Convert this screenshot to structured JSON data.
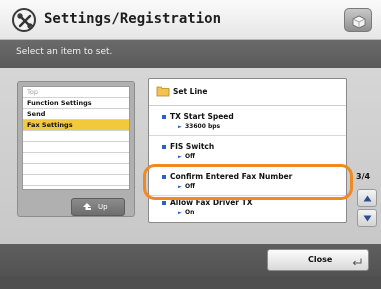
{
  "header": {
    "title": "Settings/Registration",
    "icon": "tools-icon",
    "counter_icon": "counter-check-icon"
  },
  "instruction": "Select an item to set.",
  "path": {
    "items": [
      {
        "label": "Top",
        "state": "dim"
      },
      {
        "label": "Function Settings",
        "state": "normal"
      },
      {
        "label": "Send",
        "state": "normal"
      },
      {
        "label": "Fax Settings",
        "state": "selected"
      }
    ],
    "up_label": "Up"
  },
  "list": {
    "header": "Set Line",
    "items": [
      {
        "name": "TX Start Speed",
        "value": "33600 bps"
      },
      {
        "name": "FIS Switch",
        "value": "Off"
      },
      {
        "name": "Confirm Entered Fax Number",
        "value": "Off"
      },
      {
        "name": "Allow Fax Driver TX",
        "value": "On"
      }
    ]
  },
  "pager": "3/4",
  "footer": {
    "close_label": "Close"
  },
  "colors": {
    "highlight": "#f08a1e",
    "selected_row": "#f1c93b",
    "bullet": "#2a5fd0"
  }
}
